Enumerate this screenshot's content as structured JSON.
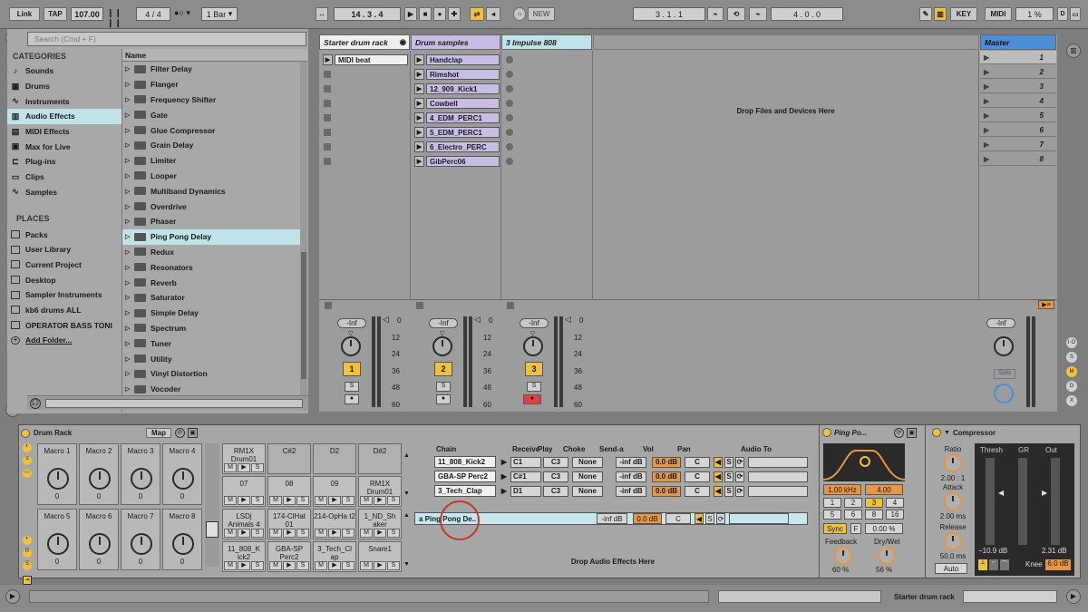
{
  "topbar": {
    "link": "Link",
    "tap": "TAP",
    "tempo": "107.00",
    "signature_num": "4",
    "signature_den": "4",
    "quantize": "1 Bar",
    "position": "14 .  3 .  4",
    "new_label": "NEW",
    "loop_start": "3 .  1 .  1",
    "loop_length": "4 .  0 .  0",
    "key": "KEY",
    "midi": "MIDI",
    "cpu": "1 %",
    "d_label": "D"
  },
  "browser": {
    "search_placeholder": "Search (Cmd + F)",
    "categories_title": "CATEGORIES",
    "categories": [
      {
        "label": "Sounds",
        "icon": "note-icon"
      },
      {
        "label": "Drums",
        "icon": "drum-grid-icon"
      },
      {
        "label": "Instruments",
        "icon": "wave-icon"
      },
      {
        "label": "Audio Effects",
        "icon": "audio-effects-icon"
      },
      {
        "label": "MIDI Effects",
        "icon": "midi-effects-icon"
      },
      {
        "label": "Max for Live",
        "icon": "max-icon"
      },
      {
        "label": "Plug-ins",
        "icon": "plug-icon"
      },
      {
        "label": "Clips",
        "icon": "clip-icon"
      },
      {
        "label": "Samples",
        "icon": "sample-icon"
      }
    ],
    "places_title": "PLACES",
    "places": [
      "Packs",
      "User Library",
      "Current Project",
      "Desktop",
      "Sampler Instruments",
      "kb6 drums ALL",
      "OPERATOR BASS TONI",
      "Add Folder..."
    ],
    "name_header": "Name",
    "effects": [
      "Filter Delay",
      "Flanger",
      "Frequency Shifter",
      "Gate",
      "Glue Compressor",
      "Grain Delay",
      "Limiter",
      "Looper",
      "Multiband Dynamics",
      "Overdrive",
      "Phaser",
      "Ping Pong Delay",
      "Redux",
      "Resonators",
      "Reverb",
      "Saturator",
      "Simple Delay",
      "Spectrum",
      "Tuner",
      "Utility",
      "Vinyl Distortion",
      "Vocoder"
    ]
  },
  "session": {
    "tracks": [
      {
        "name": "Starter drum rack",
        "clips": [
          "MIDI beat"
        ]
      },
      {
        "name": "Drum samples",
        "clips": [
          "Handclap",
          "Rimshot",
          "12_909_Kick1",
          "Cowbell",
          "4_EDM_PERC1",
          "5_EDM_PERC1",
          "6_Electro_PERC",
          "GibPerc06"
        ]
      },
      {
        "name": "3 Impulse 808",
        "clips": []
      }
    ],
    "drop_text": "Drop Files and Devices Here",
    "master": "Master",
    "scenes": [
      "1",
      "2",
      "3",
      "4",
      "5",
      "6",
      "7",
      "8"
    ],
    "mixer": {
      "vol": "-Inf",
      "scale": [
        "0",
        "12",
        "24",
        "36",
        "48",
        "60"
      ],
      "track_numbers": [
        "1",
        "2",
        "3"
      ],
      "solo": "S",
      "master_solo": "Solo"
    }
  },
  "drumrack": {
    "title": "Drum Rack",
    "map": "Map",
    "macros": [
      "Macro 1",
      "Macro 2",
      "Macro 3",
      "Macro 4",
      "Macro 5",
      "Macro 6",
      "Macro 7",
      "Macro 8"
    ],
    "macro_value": "0",
    "pads": [
      "RM1X Drum01",
      "C#2",
      "D2",
      "D#2",
      "07",
      "08",
      "09",
      "RM1X Drum01",
      "LSDj Animals 4",
      "174-ClHat 01",
      "214-OpHa t2",
      "1_ND_Sh aker",
      "11_808_K ick2",
      "GBA-SP Perc2",
      "3_Tech_Cl ap",
      "Snare1"
    ],
    "pad_m": "M",
    "pad_s": "S",
    "chain_headers": [
      "Chain",
      "Receive",
      "Play",
      "Choke",
      "Send-a",
      "Vol",
      "Pan",
      "Audio To"
    ],
    "chains": [
      {
        "name": "11_808_Kick2",
        "receive": "C1",
        "play": "C3",
        "choke": "None",
        "send": "-inf dB",
        "vol": "0.0 dB",
        "pan": "C"
      },
      {
        "name": "GBA-SP Perc2",
        "receive": "C#1",
        "play": "C3",
        "choke": "None",
        "send": "-inf dB",
        "vol": "0.0 dB",
        "pan": "C"
      },
      {
        "name": "3_Tech_Clap",
        "receive": "D1",
        "play": "C3",
        "choke": "None",
        "send": "-inf dB",
        "vol": "0.0 dB",
        "pan": "C"
      }
    ],
    "return_chain": {
      "name": "a Ping Pong De..",
      "send": "-inf dB",
      "vol": "0.0 dB",
      "pan": "C"
    },
    "drop_fx": "Drop Audio Effects Here"
  },
  "pingpong": {
    "title": "Ping Po...",
    "freq": "1.00 kHz",
    "q": "4.00",
    "beats": [
      "1",
      "2",
      "3",
      "4",
      "5",
      "6",
      "8",
      "16"
    ],
    "sync": "Sync",
    "f": "F",
    "pct": "0.00 %",
    "feedback_label": "Feedback",
    "feedback": "60 %",
    "drywet_label": "Dry/Wet",
    "drywet": "56 %"
  },
  "compressor": {
    "title": "Compressor",
    "ratio_label": "Ratio",
    "ratio": "2.00 : 1",
    "attack_label": "Attack",
    "attack": "2.00 ms",
    "release_label": "Release",
    "release": "50.0 ms",
    "auto": "Auto",
    "thresh": "Thresh",
    "gr": "GR",
    "out": "Out",
    "thresh_val": "−10.9 dB",
    "out_val": "2.31 dB",
    "knee_label": "Knee",
    "knee": "6.0 dB"
  },
  "statusbar": {
    "track": "Starter drum rack"
  },
  "colors": {
    "clip_purple": "#c9bde6",
    "accent_blue": "#bfe3e8",
    "track_yellow": "#f0c040",
    "master_blue": "#4a8fd8",
    "orange": "#e89544"
  }
}
